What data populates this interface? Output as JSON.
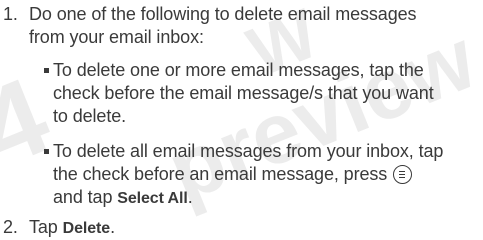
{
  "steps": [
    {
      "number": "1.",
      "line1": "Do one of the following to delete email messages",
      "line2": "from your email inbox:"
    },
    {
      "number": "2.",
      "pre": "Tap ",
      "bold": "Delete",
      "post": "."
    }
  ],
  "bullets": [
    {
      "line1": "To delete one or more email messages, tap the",
      "line2": "check before the email message/s that you want",
      "line3": "to delete."
    },
    {
      "line1": "To delete all email messages from your inbox, tap",
      "line2_pre": "the check before an email message, press ",
      "line3_pre": "and tap ",
      "line3_bold": "Select All",
      "line3_post": "."
    }
  ],
  "icons": {
    "menu_key": "menu-key-icon"
  },
  "watermark_color": "#e6e6e6"
}
